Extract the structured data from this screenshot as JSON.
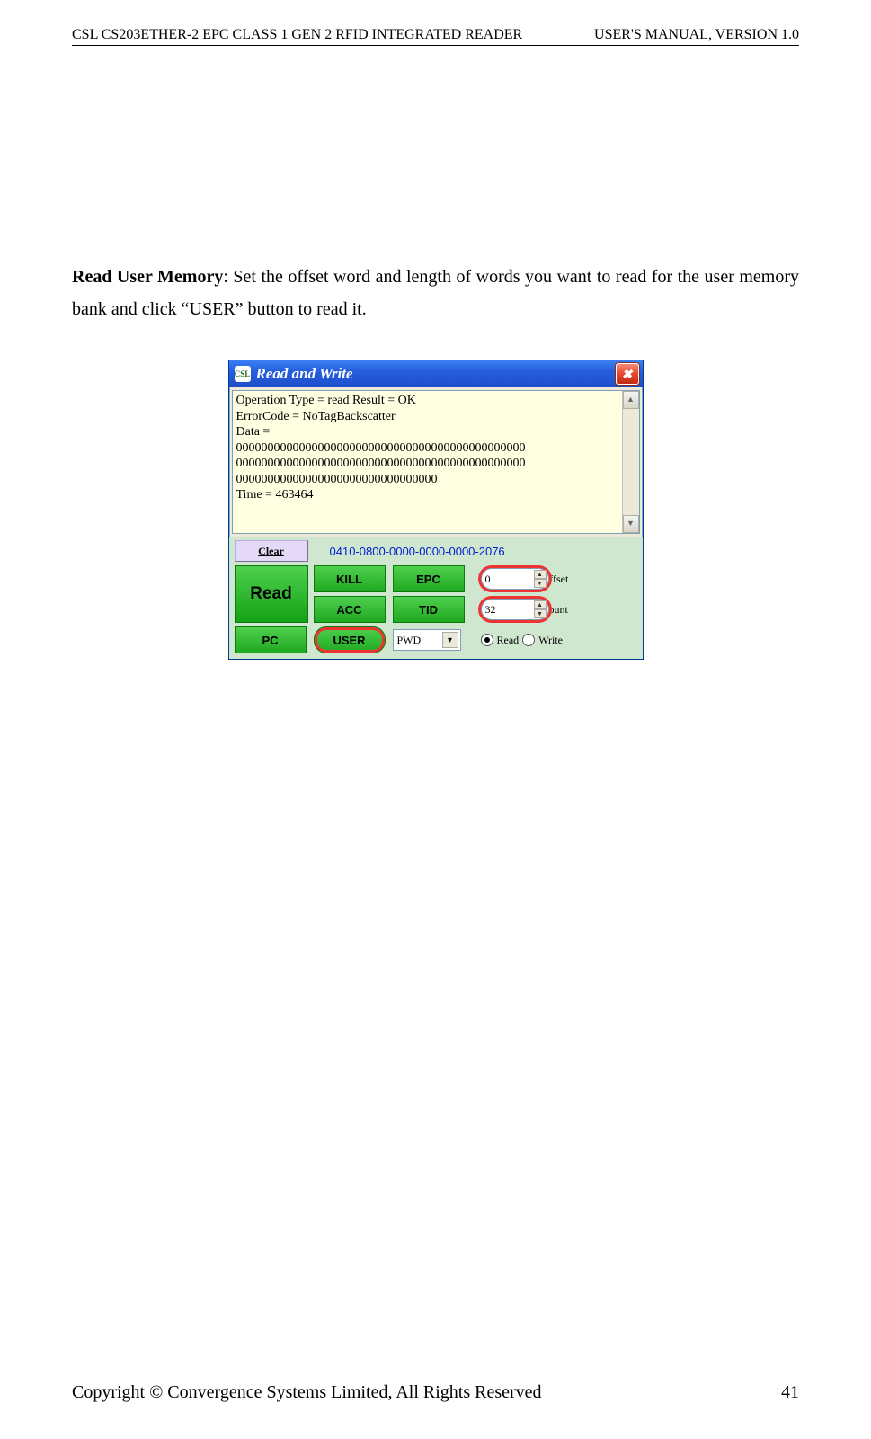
{
  "header": {
    "left": "CSL CS203ETHER-2 EPC CLASS 1 GEN 2 RFID INTEGRATED READER",
    "right": "USER'S  MANUAL,  VERSION  1.0"
  },
  "body": {
    "bold_lead": "Read User Memory",
    "rest": ": Set the offset word and length of words you want to read for the user memory bank and click “USER” button to read it."
  },
  "dialog": {
    "title": "Read and Write",
    "icon_text": "CSL",
    "close_glyph": "✖",
    "log_lines": [
      "Operation Type = read   Result = OK",
      "ErrorCode = NoTagBackscatter",
      "Data =",
      "0000000000000000000000000000000000000000000000",
      "0000000000000000000000000000000000000000000000",
      "00000000000000000000000000000000",
      "Time = 463464"
    ],
    "clear_label": "Clear",
    "tag_id": "0410-0800-0000-0000-0000-2076",
    "buttons": {
      "kill": "KILL",
      "epc": "EPC",
      "acc": "ACC",
      "tid": "TID",
      "pc": "PC",
      "user": "USER",
      "read": "Read"
    },
    "offset_value": "0",
    "offset_label": "Offset",
    "count_value": "32",
    "count_label": "Count",
    "combo_value": "PWD",
    "read_radio": "Read",
    "write_radio": "Write"
  },
  "footer": {
    "copyright": "Copyright © Convergence Systems Limited, All Rights Reserved",
    "page": "41"
  }
}
